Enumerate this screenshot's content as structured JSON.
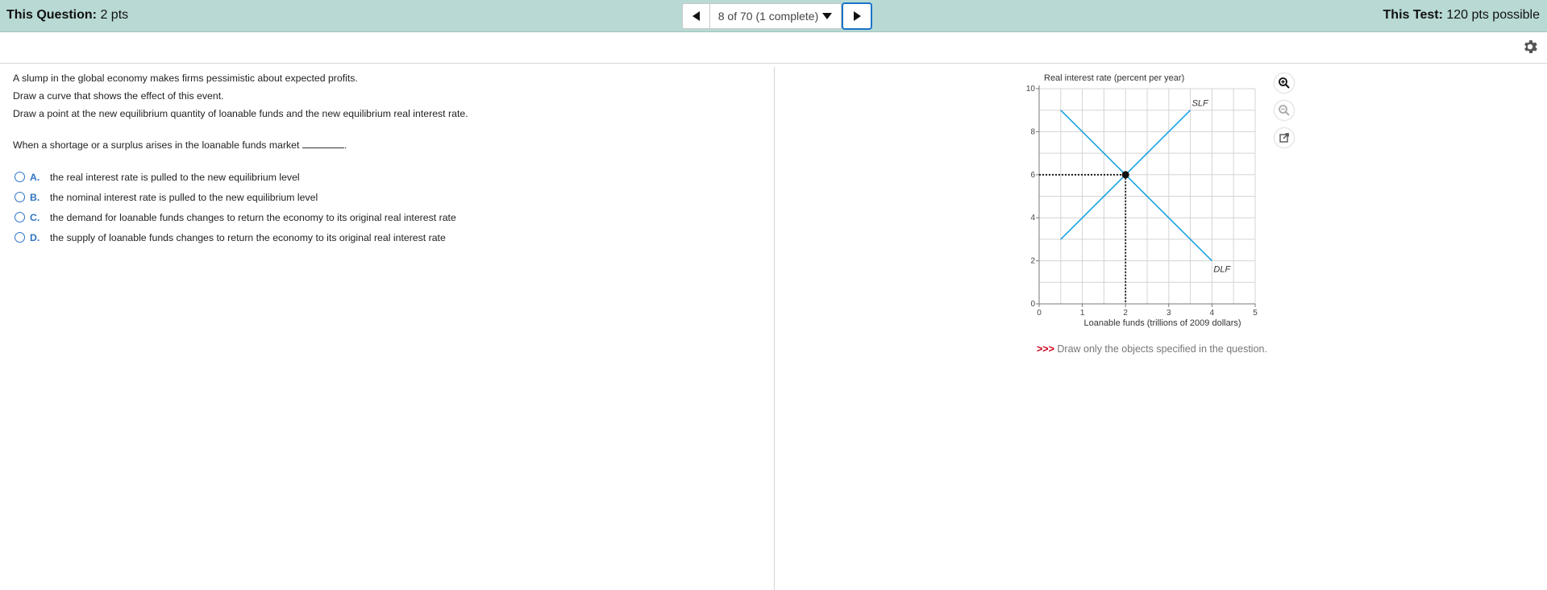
{
  "header": {
    "question_label": "This Question:",
    "question_value": "2 pts",
    "test_label": "This Test:",
    "test_value": "120 pts possible",
    "nav_position": "8 of 70 (1 complete)",
    "accent_color": "#1a73c8",
    "bar_color": "#b8d9d4"
  },
  "question": {
    "lines": [
      "A slump in the global economy makes firms pessimistic about expected profits.",
      "Draw a curve that shows the effect of this event.",
      "Draw a point at the new equilibrium quantity of loanable funds and the new equilibrium real interest rate."
    ],
    "prompt_before": "When a shortage or a surplus arises in the loanable funds market",
    "prompt_after": ".",
    "choices": [
      {
        "letter": "A.",
        "text": "the real interest rate is pulled to the new equilibrium level"
      },
      {
        "letter": "B.",
        "text": "the nominal interest rate is pulled to the new equilibrium level"
      },
      {
        "letter": "C.",
        "text": "the demand for loanable funds changes to return the economy to its original real interest rate"
      },
      {
        "letter": "D.",
        "text": "the supply of loanable funds changes to return the economy to its original real interest rate"
      }
    ]
  },
  "note": {
    "arrows": ">>>",
    "text": " Draw only the objects specified in the question."
  },
  "icons": {
    "prev": "triangle-left-icon",
    "next": "triangle-right-icon",
    "caret": "caret-down-icon",
    "settings": "gear-icon",
    "zoom_in": "zoom-in-icon",
    "zoom_out": "zoom-out-icon",
    "popout": "external-link-icon"
  },
  "chart_data": {
    "type": "line",
    "xlabel": "Loanable funds (trillions of 2009 dollars)",
    "ylabel": "Real interest rate (percent per year)",
    "xlim": [
      0,
      5
    ],
    "ylim": [
      0,
      10
    ],
    "xticks": [
      "0",
      "1",
      "2",
      "3",
      "4",
      "5"
    ],
    "yticks": [
      "0",
      "2",
      "4",
      "6",
      "8",
      "10"
    ],
    "grid": true,
    "line_color": "#1aa3e0",
    "series": [
      {
        "name": "SLF",
        "x": [
          0.5,
          3.5
        ],
        "y": [
          3,
          9
        ]
      },
      {
        "name": "DLF",
        "x": [
          0.5,
          4
        ],
        "y": [
          9,
          2
        ]
      }
    ],
    "equilibrium": {
      "x": 2,
      "y": 6
    }
  }
}
